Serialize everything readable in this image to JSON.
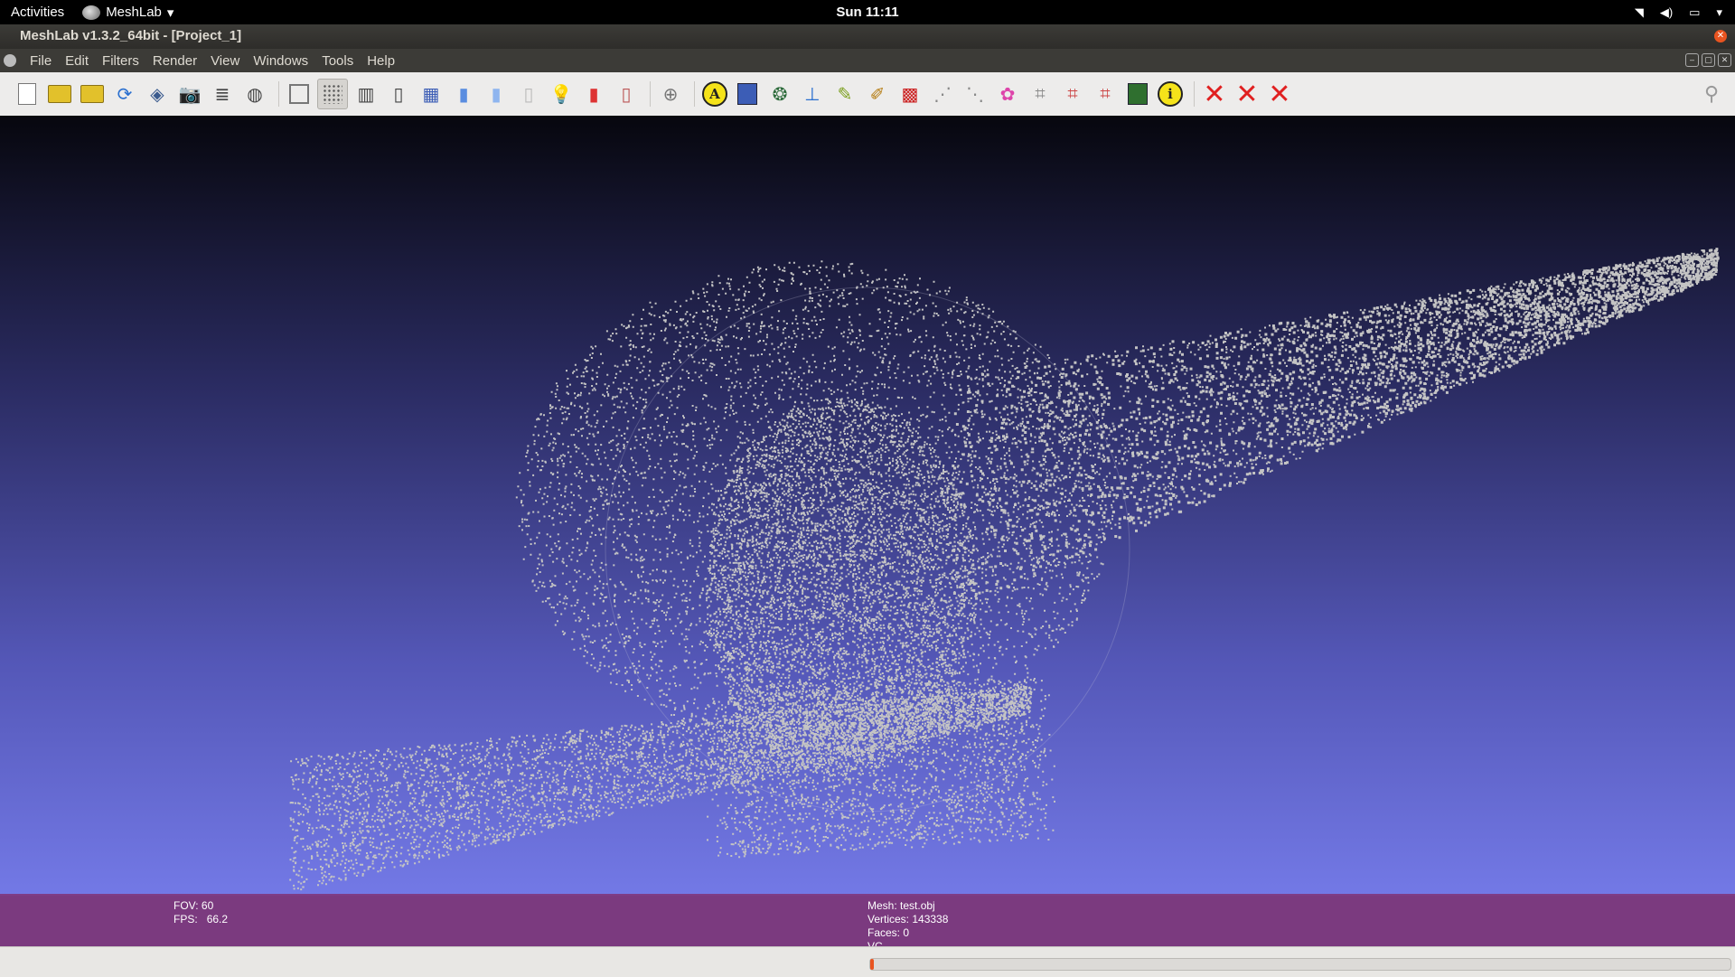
{
  "system_bar": {
    "activities": "Activities",
    "app_name": "MeshLab",
    "clock": "Sun 11:11",
    "tray_icons": [
      "wifi-icon",
      "volume-icon",
      "battery-icon",
      "menu-arrow-icon"
    ]
  },
  "window": {
    "title": "MeshLab v1.3.2_64bit - [Project_1]"
  },
  "menu": {
    "items": [
      "File",
      "Edit",
      "Filters",
      "Render",
      "View",
      "Windows",
      "Tools",
      "Help"
    ]
  },
  "toolbar": {
    "icons": [
      "new-icon",
      "open-project-icon",
      "open-mesh-icon",
      "reload-icon",
      "save-icon",
      "snapshot-icon",
      "layers-icon",
      "sphere-icon",
      "bbox-icon",
      "points-icon",
      "wireframe-icon",
      "hidden-lines-icon",
      "flat-lines-icon",
      "flat-icon",
      "smooth-icon",
      "texture-icon",
      "light-icon",
      "fancy-lighting-icon",
      "backface-icon",
      "trackball-icon",
      "annotation-icon",
      "shader-icon",
      "sphere-map-icon",
      "measure-icon",
      "paint-icon",
      "brush-icon",
      "select-faces-icon",
      "select-vertices-icon",
      "align-icon",
      "color-icon",
      "connected-icon",
      "delete-faces-icon",
      "delete-vertices-icon",
      "render-view-icon",
      "info-icon",
      "delete-icon",
      "delete-all-icon",
      "cut-icon",
      "search-icon"
    ],
    "active": "points-icon"
  },
  "info": {
    "fov_label": "FOV: 60",
    "fps_label": "FPS:",
    "fps_value": "66.2",
    "mesh_label": "Mesh: test.obj",
    "vertices_label": "Vertices: 143338",
    "faces_label": "Faces: 0",
    "vc_label": "VC"
  },
  "status": {
    "progress": 0.004
  },
  "colors": {
    "accent": "#e95420",
    "info_bar": "#7e3b82",
    "point_color": "#c4c4c4"
  }
}
